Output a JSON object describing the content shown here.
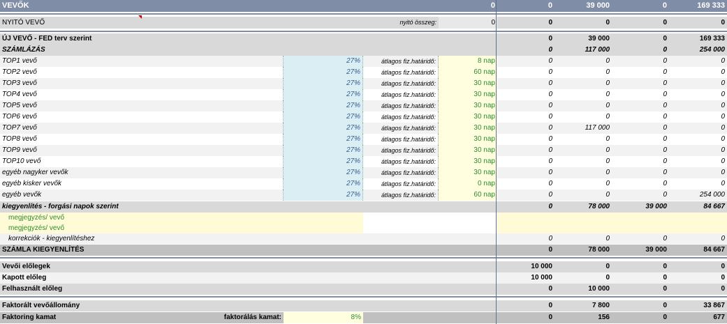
{
  "header": {
    "title": "VEVŐK",
    "values": [
      "0",
      "0",
      "39 000",
      "0",
      "169 333"
    ]
  },
  "nyito": {
    "label": "NYITÓ VEVŐ",
    "sub_label": "nyitó összeg:",
    "input": "0",
    "values": [
      "0",
      "0",
      "0",
      "0"
    ]
  },
  "uj_vevo": {
    "label": "ÚJ VEVŐ - FED terv szerint",
    "values": [
      "0",
      "39 000",
      "0",
      "169 333"
    ]
  },
  "szamlazas": {
    "label": "SZÁMLÁZÁS",
    "values": [
      "0",
      "117 000",
      "0",
      "254 000"
    ]
  },
  "customer_rows": [
    {
      "name": "TOP1 vevő",
      "pct": "27%",
      "term_label": "átlagos fiz.határidő:",
      "term": "8 nap",
      "values": [
        "0",
        "0",
        "0",
        "0"
      ]
    },
    {
      "name": "TOP2 vevő",
      "pct": "27%",
      "term_label": "átlagos fiz.határidő:",
      "term": "60 nap",
      "values": [
        "0",
        "0",
        "0",
        "0"
      ]
    },
    {
      "name": "TOP3 vevő",
      "pct": "27%",
      "term_label": "átlagos fiz.határidő:",
      "term": "30 nap",
      "values": [
        "0",
        "0",
        "0",
        "0"
      ]
    },
    {
      "name": "TOP4 vevő",
      "pct": "27%",
      "term_label": "átlagos fiz.határidő:",
      "term": "30 nap",
      "values": [
        "0",
        "0",
        "0",
        "0"
      ]
    },
    {
      "name": "TOP5 vevő",
      "pct": "27%",
      "term_label": "átlagos fiz.határidő:",
      "term": "30 nap",
      "values": [
        "0",
        "0",
        "0",
        "0"
      ]
    },
    {
      "name": "TOP6 vevő",
      "pct": "27%",
      "term_label": "átlagos fiz.határidő:",
      "term": "30 nap",
      "values": [
        "0",
        "0",
        "0",
        "0"
      ]
    },
    {
      "name": "TOP7 vevő",
      "pct": "27%",
      "term_label": "átlagos fiz.határidő:",
      "term": "30 nap",
      "values": [
        "0",
        "117 000",
        "0",
        "0"
      ]
    },
    {
      "name": "TOP8 vevő",
      "pct": "27%",
      "term_label": "átlagos fiz.határidő:",
      "term": "30 nap",
      "values": [
        "0",
        "0",
        "0",
        "0"
      ]
    },
    {
      "name": "TOP9 vevő",
      "pct": "27%",
      "term_label": "átlagos fiz.határidő:",
      "term": "30 nap",
      "values": [
        "0",
        "0",
        "0",
        "0"
      ]
    },
    {
      "name": "TOP10 vevő",
      "pct": "27%",
      "term_label": "átlagos fiz.határidő:",
      "term": "30 nap",
      "values": [
        "0",
        "0",
        "0",
        "0"
      ]
    },
    {
      "name": "egyéb nagyker vevők",
      "pct": "27%",
      "term_label": "átlagos fiz.határidő:",
      "term": "30 nap",
      "values": [
        "0",
        "0",
        "0",
        "0"
      ]
    },
    {
      "name": "egyéb kisker vevők",
      "pct": "27%",
      "term_label": "átlagos fiz.határidő:",
      "term": "0 nap",
      "values": [
        "0",
        "0",
        "0",
        "0"
      ]
    },
    {
      "name": "egyéb vevők",
      "pct": "27%",
      "term_label": "átlagos fiz.határidő:",
      "term": "60 nap",
      "values": [
        "0",
        "0",
        "0",
        "254 000"
      ]
    }
  ],
  "kiegyenlites": {
    "label": "kiegyenlítés - forgási napok szerint",
    "values": [
      "0",
      "78 000",
      "39 000",
      "84 667"
    ]
  },
  "notes": [
    "megjegyzés/ vevő",
    "megjegyzés/ vevő"
  ],
  "korrekcio": {
    "label": "korrekciók - kiegyenlítéshez",
    "values": [
      "0",
      "0",
      "0",
      "0"
    ]
  },
  "szamla_kiegy": {
    "label": "SZÁMLA KIEGYENLÍTÉS",
    "values": [
      "0",
      "78 000",
      "39 000",
      "84 667"
    ]
  },
  "vevoi_elolegek": {
    "label": "Vevői előlegek",
    "values": [
      "10 000",
      "0",
      "0",
      "0"
    ]
  },
  "kapott_eloleg": {
    "label": "Kapott előleg",
    "values": [
      "10 000",
      "0",
      "0",
      "0"
    ]
  },
  "felhasznalt": {
    "label": "Felhasznált előleg",
    "values": [
      "0",
      "10 000",
      "0",
      "0"
    ]
  },
  "faktoralt": {
    "label": "Faktorált vevőállomány",
    "values": [
      "0",
      "7 800",
      "0",
      "33 867"
    ]
  },
  "faktoring": {
    "label": "Faktoring kamat",
    "sub_label": "faktorálás kamat:",
    "input": "8%",
    "values": [
      "0",
      "156",
      "0",
      "677"
    ]
  }
}
